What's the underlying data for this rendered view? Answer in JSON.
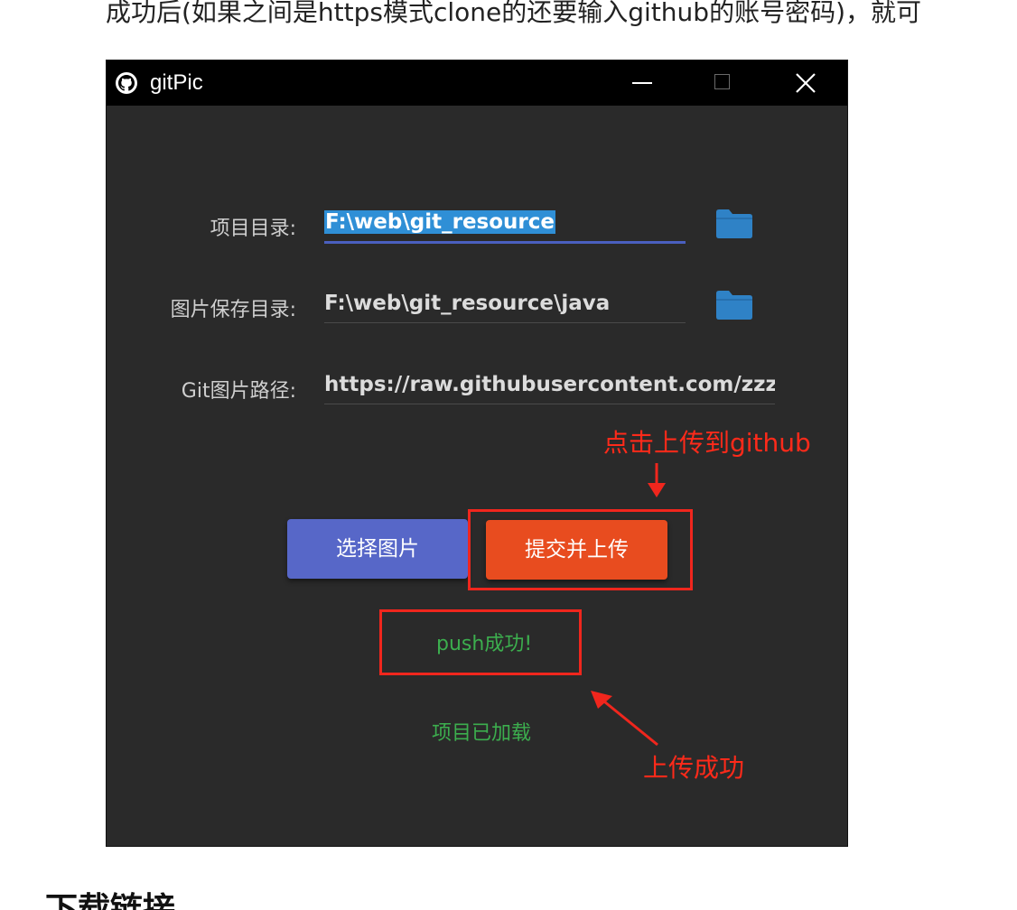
{
  "doc": {
    "top_line": "成功后(如果之间是https模式clone的还要输入github的账号密码)，就可",
    "bottom_heading": "下载链接"
  },
  "window": {
    "title": "gitPic",
    "controls": {
      "minimize": "minimize-icon",
      "maximize": "maximize-icon",
      "close": "close-icon"
    }
  },
  "form": {
    "project_dir": {
      "label": "项目目录:",
      "value": "F:\\web\\git_resource"
    },
    "image_dir": {
      "label": "图片保存目录:",
      "value": "F:\\web\\git_resource\\java"
    },
    "git_path": {
      "label": "Git图片路径:",
      "value": "https://raw.githubusercontent.com/zzzzbw/gitPic/master/java"
    }
  },
  "buttons": {
    "select_image": "选择图片",
    "submit_upload": "提交并上传"
  },
  "status": {
    "push_result": "push成功!",
    "project_loaded": "项目已加载"
  },
  "annotations": {
    "upload_hint": "点击上传到github",
    "success_hint": "上传成功",
    "color": "#f0261d"
  },
  "colors": {
    "window_bg": "#2a2a2a",
    "titlebar_bg": "#000000",
    "select_button": "#5767c8",
    "submit_button": "#e84c1f",
    "folder_icon": "#2f82c6",
    "status_text": "#3cae4e"
  }
}
